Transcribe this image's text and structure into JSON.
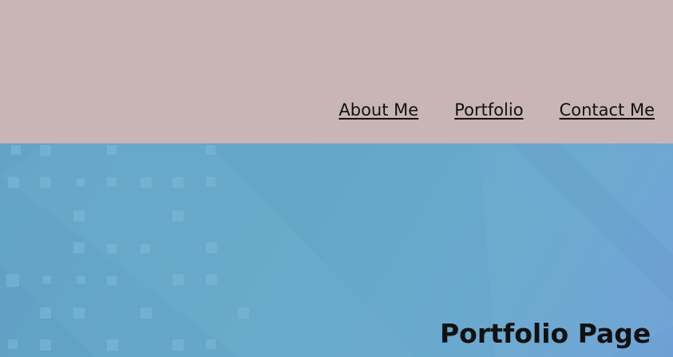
{
  "nav": {
    "items": [
      {
        "label": "About Me"
      },
      {
        "label": "Portfolio"
      },
      {
        "label": "Contact Me"
      }
    ]
  },
  "hero": {
    "title": "Portfolio Page"
  },
  "colors": {
    "header_bg": "#c9b5b5",
    "hero_bg": "#65a6c8",
    "text": "#111111"
  }
}
